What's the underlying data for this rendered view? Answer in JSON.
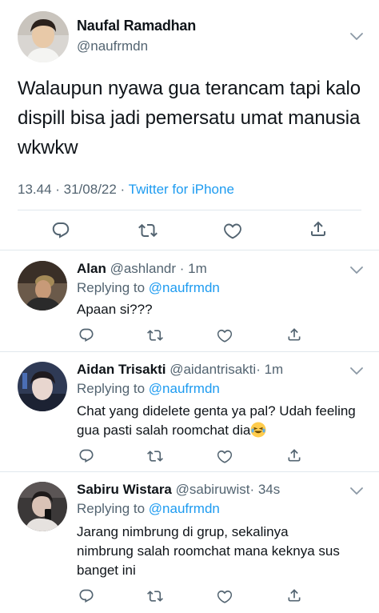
{
  "main_tweet": {
    "author_name": "Naufal Ramadhan",
    "author_handle": "@naufrmdn",
    "text": "Walaupun nyawa gua terancam tapi kalo dispill bisa jadi pemersatu umat manusia wkwkw",
    "time_date": "13.44 · 31/08/22 · ",
    "source": "Twitter for iPhone"
  },
  "replies": [
    {
      "name": "Alan",
      "handle": "@ashlandr",
      "time": "· 1m",
      "replying_prefix": "Replying to ",
      "replying_to": "@naufrmdn",
      "text": "Apaan si???"
    },
    {
      "name": "Aidan Trisakti",
      "handle": "@aidantrisakti",
      "time": "· 1m",
      "replying_prefix": "Replying to ",
      "replying_to": "@naufrmdn",
      "text": "Chat yang didelete genta ya pal? Udah feeling gua pasti salah roomchat dia"
    },
    {
      "name": "Sabiru Wistara",
      "handle": "@sabiruwist",
      "time": "· 34s",
      "replying_prefix": "Replying to ",
      "replying_to": "@naufrmdn",
      "text": "Jarang nimbrung di grup, sekalinya nimbrung salah roomchat mana keknya sus banget ini"
    }
  ],
  "colors": {
    "text": "#0f1419",
    "secondary": "#536471",
    "link": "#1d9bf0",
    "divider": "#e1e8ed"
  },
  "icons": [
    "reply-icon",
    "retweet-icon",
    "like-icon",
    "share-icon",
    "chevron-down-icon",
    "laughing-emoji"
  ]
}
